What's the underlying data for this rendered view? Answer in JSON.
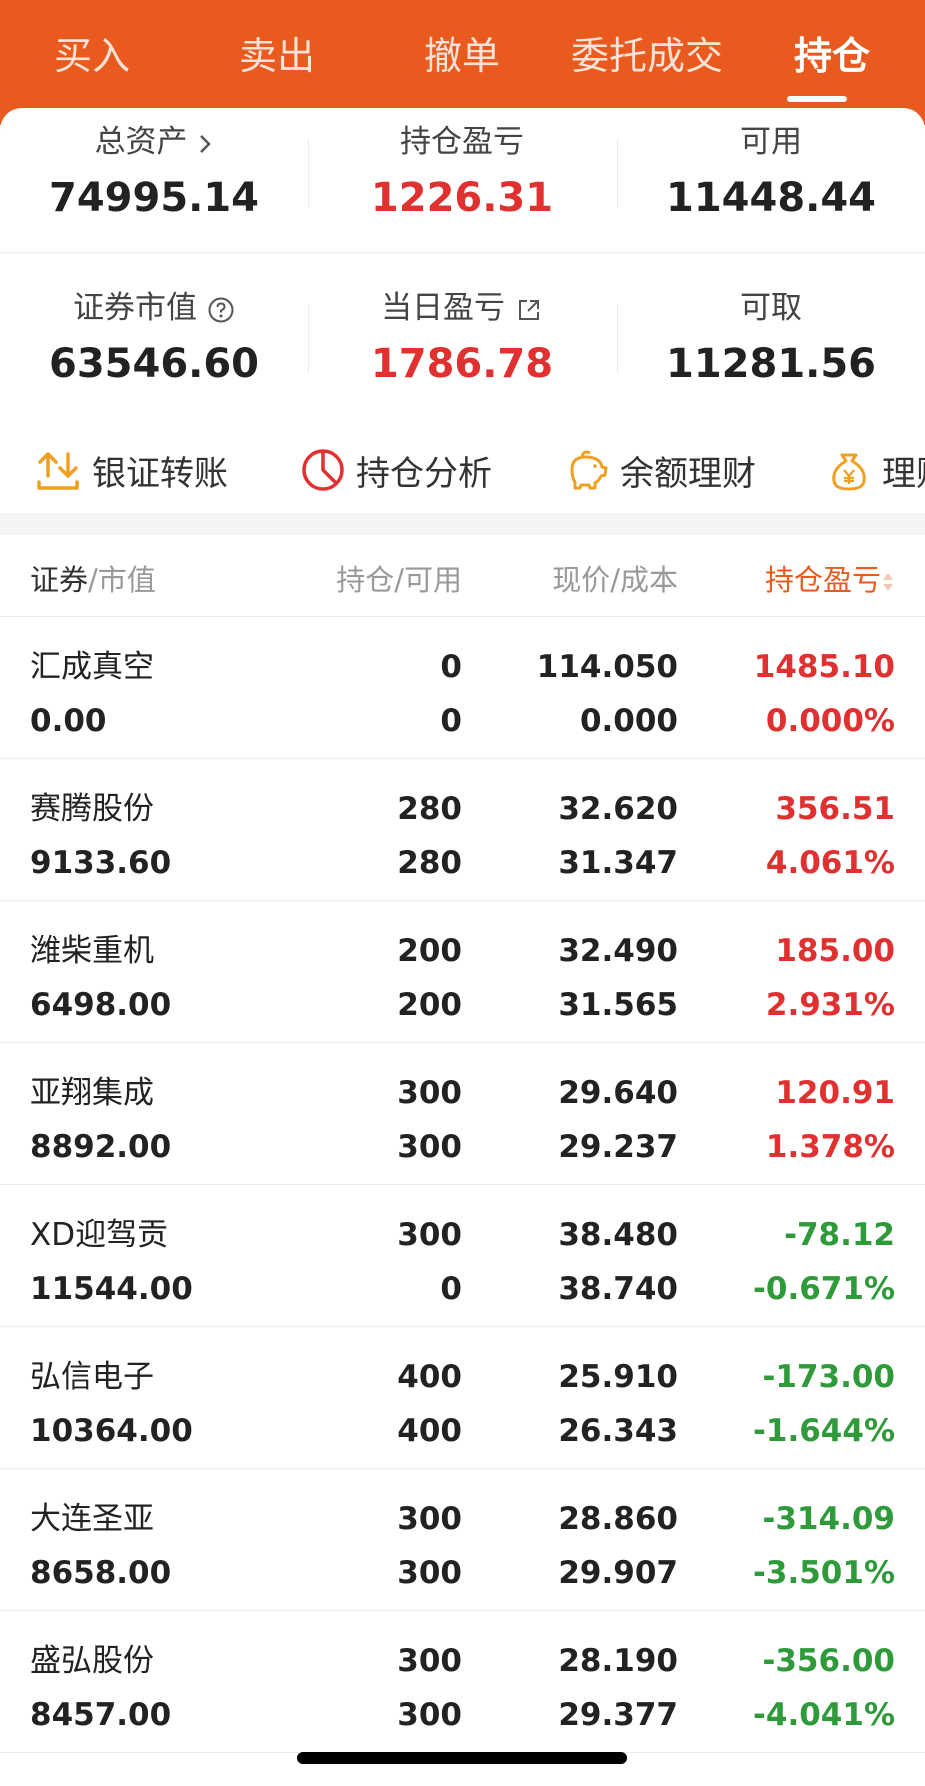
{
  "tabs": [
    {
      "label": "买入"
    },
    {
      "label": "卖出"
    },
    {
      "label": "撤单"
    },
    {
      "label": "委托成交"
    },
    {
      "label": "持仓"
    }
  ],
  "summary": {
    "total_assets_label": "总资产",
    "total_assets": "74995.14",
    "position_pl_label": "持仓盈亏",
    "position_pl": "1226.31",
    "available_label": "可用",
    "available": "11448.44",
    "market_value_label": "证券市值",
    "market_value": "63546.60",
    "daily_pl_label": "当日盈亏",
    "daily_pl": "1786.78",
    "withdrawable_label": "可取",
    "withdrawable": "11281.56"
  },
  "quick_actions": [
    {
      "label": "银证转账",
      "icon": "transfer-icon"
    },
    {
      "label": "持仓分析",
      "icon": "pie-chart-icon"
    },
    {
      "label": "余额理财",
      "icon": "piggy-bank-icon"
    },
    {
      "label": "理财",
      "icon": "money-bag-icon"
    }
  ],
  "table": {
    "headers": {
      "security": "证券",
      "market_value": "/市值",
      "position": "持仓",
      "available": "/可用",
      "price": "现价",
      "cost": "/成本",
      "pl": "持仓盈亏"
    },
    "rows": [
      {
        "name": "汇成真空",
        "market_value": "0.00",
        "position": "0",
        "available": "0",
        "price": "114.050",
        "cost": "0.000",
        "pl": "1485.10",
        "pl_pct": "0.000%",
        "trend": "up"
      },
      {
        "name": "赛腾股份",
        "market_value": "9133.60",
        "position": "280",
        "available": "280",
        "price": "32.620",
        "cost": "31.347",
        "pl": "356.51",
        "pl_pct": "4.061%",
        "trend": "up"
      },
      {
        "name": "潍柴重机",
        "market_value": "6498.00",
        "position": "200",
        "available": "200",
        "price": "32.490",
        "cost": "31.565",
        "pl": "185.00",
        "pl_pct": "2.931%",
        "trend": "up"
      },
      {
        "name": "亚翔集成",
        "market_value": "8892.00",
        "position": "300",
        "available": "300",
        "price": "29.640",
        "cost": "29.237",
        "pl": "120.91",
        "pl_pct": "1.378%",
        "trend": "up"
      },
      {
        "name": "XD迎驾贡",
        "market_value": "11544.00",
        "position": "300",
        "available": "0",
        "price": "38.480",
        "cost": "38.740",
        "pl": "-78.12",
        "pl_pct": "-0.671%",
        "trend": "down"
      },
      {
        "name": "弘信电子",
        "market_value": "10364.00",
        "position": "400",
        "available": "400",
        "price": "25.910",
        "cost": "26.343",
        "pl": "-173.00",
        "pl_pct": "-1.644%",
        "trend": "down"
      },
      {
        "name": "大连圣亚",
        "market_value": "8658.00",
        "position": "300",
        "available": "300",
        "price": "28.860",
        "cost": "29.907",
        "pl": "-314.09",
        "pl_pct": "-3.501%",
        "trend": "down"
      },
      {
        "name": "盛弘股份",
        "market_value": "8457.00",
        "position": "300",
        "available": "300",
        "price": "28.190",
        "cost": "29.377",
        "pl": "-356.00",
        "pl_pct": "-4.041%",
        "trend": "down"
      }
    ]
  },
  "colors": {
    "brand": "#e85a1e",
    "gain": "#e03030",
    "loss": "#2e9a3a",
    "icon_gold": "#f0a020",
    "icon_red": "#e03030"
  }
}
